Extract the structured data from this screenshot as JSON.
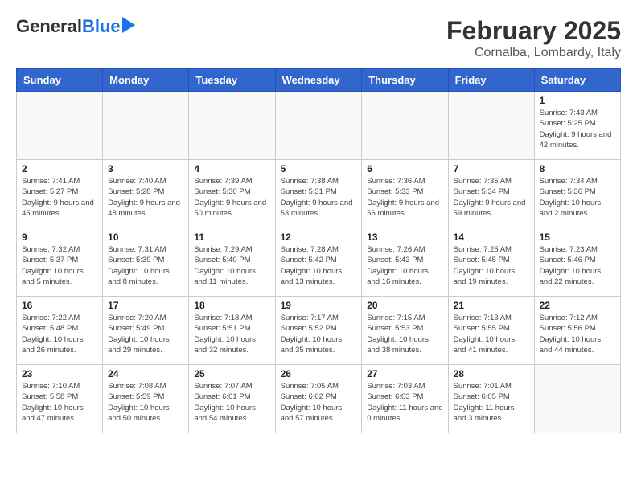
{
  "header": {
    "logo_general": "General",
    "logo_blue": "Blue",
    "title": "February 2025",
    "subtitle": "Cornalba, Lombardy, Italy"
  },
  "weekdays": [
    "Sunday",
    "Monday",
    "Tuesday",
    "Wednesday",
    "Thursday",
    "Friday",
    "Saturday"
  ],
  "weeks": [
    [
      {
        "day": "",
        "info": ""
      },
      {
        "day": "",
        "info": ""
      },
      {
        "day": "",
        "info": ""
      },
      {
        "day": "",
        "info": ""
      },
      {
        "day": "",
        "info": ""
      },
      {
        "day": "",
        "info": ""
      },
      {
        "day": "1",
        "info": "Sunrise: 7:43 AM\nSunset: 5:25 PM\nDaylight: 9 hours and 42 minutes."
      }
    ],
    [
      {
        "day": "2",
        "info": "Sunrise: 7:41 AM\nSunset: 5:27 PM\nDaylight: 9 hours and 45 minutes."
      },
      {
        "day": "3",
        "info": "Sunrise: 7:40 AM\nSunset: 5:28 PM\nDaylight: 9 hours and 48 minutes."
      },
      {
        "day": "4",
        "info": "Sunrise: 7:39 AM\nSunset: 5:30 PM\nDaylight: 9 hours and 50 minutes."
      },
      {
        "day": "5",
        "info": "Sunrise: 7:38 AM\nSunset: 5:31 PM\nDaylight: 9 hours and 53 minutes."
      },
      {
        "day": "6",
        "info": "Sunrise: 7:36 AM\nSunset: 5:33 PM\nDaylight: 9 hours and 56 minutes."
      },
      {
        "day": "7",
        "info": "Sunrise: 7:35 AM\nSunset: 5:34 PM\nDaylight: 9 hours and 59 minutes."
      },
      {
        "day": "8",
        "info": "Sunrise: 7:34 AM\nSunset: 5:36 PM\nDaylight: 10 hours and 2 minutes."
      }
    ],
    [
      {
        "day": "9",
        "info": "Sunrise: 7:32 AM\nSunset: 5:37 PM\nDaylight: 10 hours and 5 minutes."
      },
      {
        "day": "10",
        "info": "Sunrise: 7:31 AM\nSunset: 5:39 PM\nDaylight: 10 hours and 8 minutes."
      },
      {
        "day": "11",
        "info": "Sunrise: 7:29 AM\nSunset: 5:40 PM\nDaylight: 10 hours and 11 minutes."
      },
      {
        "day": "12",
        "info": "Sunrise: 7:28 AM\nSunset: 5:42 PM\nDaylight: 10 hours and 13 minutes."
      },
      {
        "day": "13",
        "info": "Sunrise: 7:26 AM\nSunset: 5:43 PM\nDaylight: 10 hours and 16 minutes."
      },
      {
        "day": "14",
        "info": "Sunrise: 7:25 AM\nSunset: 5:45 PM\nDaylight: 10 hours and 19 minutes."
      },
      {
        "day": "15",
        "info": "Sunrise: 7:23 AM\nSunset: 5:46 PM\nDaylight: 10 hours and 22 minutes."
      }
    ],
    [
      {
        "day": "16",
        "info": "Sunrise: 7:22 AM\nSunset: 5:48 PM\nDaylight: 10 hours and 26 minutes."
      },
      {
        "day": "17",
        "info": "Sunrise: 7:20 AM\nSunset: 5:49 PM\nDaylight: 10 hours and 29 minutes."
      },
      {
        "day": "18",
        "info": "Sunrise: 7:18 AM\nSunset: 5:51 PM\nDaylight: 10 hours and 32 minutes."
      },
      {
        "day": "19",
        "info": "Sunrise: 7:17 AM\nSunset: 5:52 PM\nDaylight: 10 hours and 35 minutes."
      },
      {
        "day": "20",
        "info": "Sunrise: 7:15 AM\nSunset: 5:53 PM\nDaylight: 10 hours and 38 minutes."
      },
      {
        "day": "21",
        "info": "Sunrise: 7:13 AM\nSunset: 5:55 PM\nDaylight: 10 hours and 41 minutes."
      },
      {
        "day": "22",
        "info": "Sunrise: 7:12 AM\nSunset: 5:56 PM\nDaylight: 10 hours and 44 minutes."
      }
    ],
    [
      {
        "day": "23",
        "info": "Sunrise: 7:10 AM\nSunset: 5:58 PM\nDaylight: 10 hours and 47 minutes."
      },
      {
        "day": "24",
        "info": "Sunrise: 7:08 AM\nSunset: 5:59 PM\nDaylight: 10 hours and 50 minutes."
      },
      {
        "day": "25",
        "info": "Sunrise: 7:07 AM\nSunset: 6:01 PM\nDaylight: 10 hours and 54 minutes."
      },
      {
        "day": "26",
        "info": "Sunrise: 7:05 AM\nSunset: 6:02 PM\nDaylight: 10 hours and 57 minutes."
      },
      {
        "day": "27",
        "info": "Sunrise: 7:03 AM\nSunset: 6:03 PM\nDaylight: 11 hours and 0 minutes."
      },
      {
        "day": "28",
        "info": "Sunrise: 7:01 AM\nSunset: 6:05 PM\nDaylight: 11 hours and 3 minutes."
      },
      {
        "day": "",
        "info": ""
      }
    ]
  ]
}
